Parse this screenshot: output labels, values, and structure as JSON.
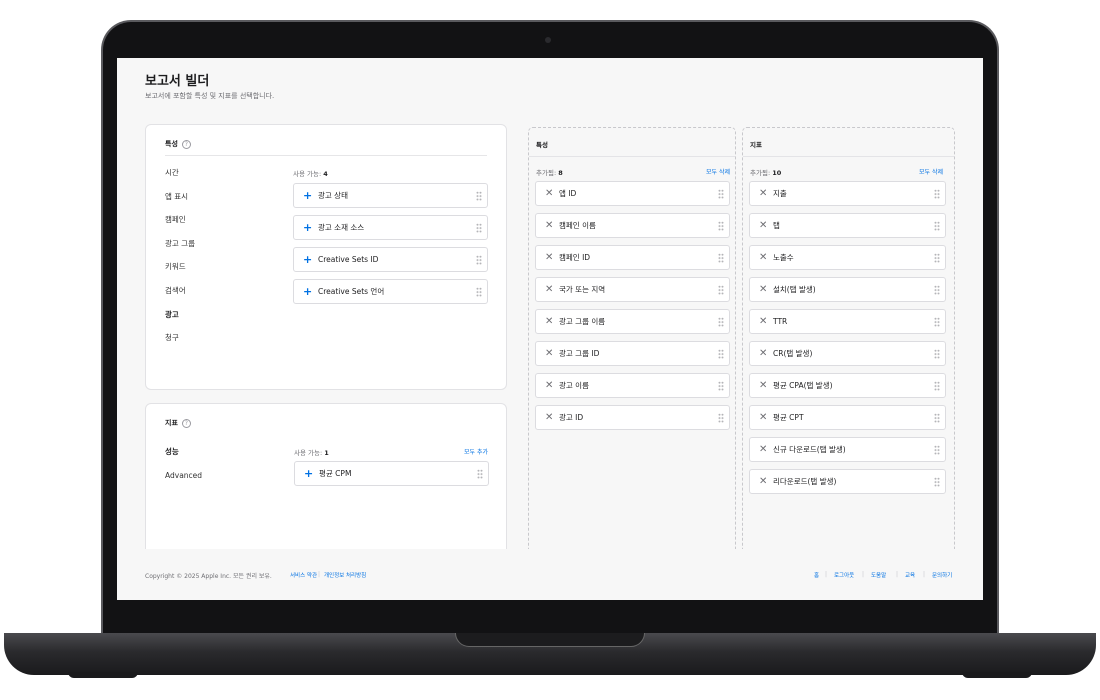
{
  "page": {
    "title": "보고서 빌더",
    "subtitle": "보고서에 포함할 특성 및 지표를 선택합니다."
  },
  "attributes_panel": {
    "title": "특성",
    "help_icon": "?",
    "categories": [
      "시간",
      "앱 표시",
      "캠페인",
      "광고 그룹",
      "키워드",
      "검색어",
      "광고",
      "청구"
    ],
    "active_category": "광고",
    "available_label": "사용 가능: ",
    "available_count": "4",
    "items": [
      "광고 상태",
      "광고 소재 소스",
      "Creative Sets ID",
      "Creative Sets 언어"
    ]
  },
  "metrics_panel": {
    "title": "지표",
    "help_icon": "?",
    "categories": [
      "성능",
      "Advanced"
    ],
    "active_category": "성능",
    "available_label": "사용 가능: ",
    "available_count": "1",
    "add_all": "모두 추가",
    "items": [
      "평균 CPM"
    ]
  },
  "selected_attributes": {
    "title": "특성",
    "added_label": "추가됨: ",
    "added_count": "8",
    "remove_all": "모두 삭제",
    "items": [
      "앱 ID",
      "캠페인 이름",
      "캠페인 ID",
      "국가 또는 지역",
      "광고 그룹 이름",
      "광고 그룹 ID",
      "광고 이름",
      "광고 ID"
    ]
  },
  "selected_metrics": {
    "title": "지표",
    "added_label": "추가됨: ",
    "added_count": "10",
    "remove_all": "모두 삭제",
    "items": [
      "지출",
      "탭",
      "노출수",
      "설치(탭 발생)",
      "TTR",
      "CR(탭 발생)",
      "평균 CPA(탭 발생)",
      "평균 CPT",
      "신규 다운로드(탭 발생)",
      "리다운로드(탭 발생)"
    ]
  },
  "icons": {
    "add": "+",
    "remove": "✕"
  },
  "colors": {
    "accent": "#0071e3"
  },
  "footer": {
    "copyright": "Copyright © 2025 Apple Inc. 모든 권리 보유.",
    "left_links": [
      "서비스 약관",
      "개인정보 처리방침"
    ],
    "right_links": [
      "홈",
      "로그아웃",
      "도움말",
      "교육",
      "문의하기"
    ]
  }
}
